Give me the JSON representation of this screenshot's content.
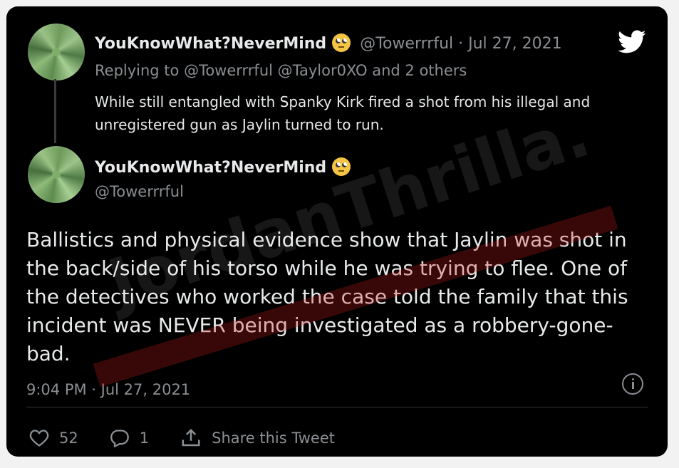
{
  "reply_tweet": {
    "display_name": "YouKnowWhat?NeverMind",
    "handle_and_date": "@Towerrrful · Jul 27, 2021",
    "replying_to": "Replying to @Towerrrful @Taylor0XO and 2 others",
    "text": "While still entangled with Spanky Kirk fired a shot from his illegal and unregistered gun as Jaylin turned to run.",
    "emoji": "face-with-rolling-eyes"
  },
  "main_tweet": {
    "display_name": "YouKnowWhat?NeverMind",
    "handle": "@Towerrrful",
    "text": "Ballistics and physical evidence show that Jaylin was shot in the back/side of his torso while he was trying to flee. One of the detectives who worked the case told the family that this incident was NEVER being investigated as a robbery-gone-bad.",
    "timestamp": "9:04 PM · Jul 27, 2021",
    "emoji": "face-with-rolling-eyes"
  },
  "actions": {
    "likes": "52",
    "replies": "1",
    "share_label": "Share this Tweet"
  },
  "watermark": {
    "text": "JordanThrilla."
  },
  "icons": {
    "brand": "twitter-bird-icon",
    "info": "info-icon",
    "like": "heart-icon",
    "reply": "reply-bubble-icon",
    "share": "share-icon"
  },
  "colors": {
    "background": "#000000",
    "text": "#e7e9ea",
    "muted": "#8b8f93",
    "twitter_icon": "#ffffff"
  }
}
